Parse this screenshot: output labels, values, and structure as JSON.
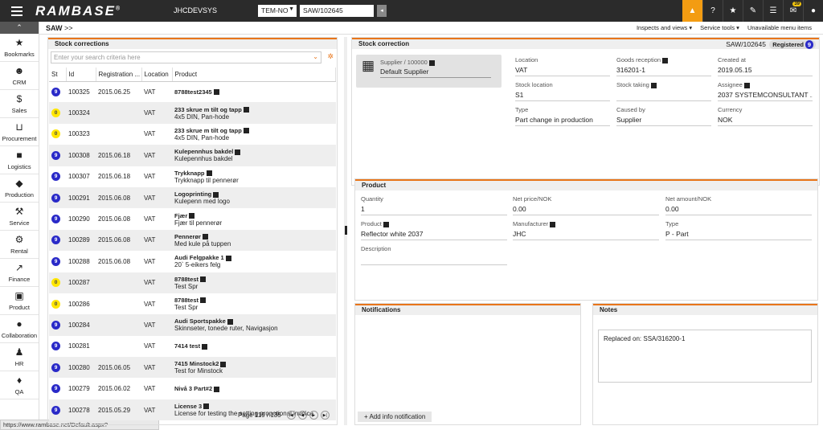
{
  "topbar": {
    "logo": "RAMBASE",
    "company": "JHCDEVSYS",
    "company_select": "TEM-NO",
    "doc_input": "SAW/102645",
    "mail_badge": "39"
  },
  "sidebar": {
    "items": [
      {
        "label": "Bookmarks",
        "icon": "star-icon"
      },
      {
        "label": "CRM",
        "icon": "users-icon"
      },
      {
        "label": "Sales",
        "icon": "money-bag-icon"
      },
      {
        "label": "Procurement",
        "icon": "cart-icon"
      },
      {
        "label": "Logistics",
        "icon": "truck-icon"
      },
      {
        "label": "Production",
        "icon": "boxes-icon"
      },
      {
        "label": "Service",
        "icon": "wrench-icon"
      },
      {
        "label": "Rental",
        "icon": "rental-icon"
      },
      {
        "label": "Finance",
        "icon": "chart-line-icon"
      },
      {
        "label": "Product",
        "icon": "box-icon"
      },
      {
        "label": "Collaboration",
        "icon": "chat-icon"
      },
      {
        "label": "HR",
        "icon": "person-icon"
      },
      {
        "label": "QA",
        "icon": "thumbs-up-icon"
      }
    ]
  },
  "status_url": "https://www.rambase.net/Default.aspx?target=JHCDEVSYS",
  "breadcrumb": {
    "main": "SAW",
    "rest": ">>"
  },
  "menu_links": [
    "Inspects and views ▾",
    "Service tools ▾",
    "Unavailable menu items"
  ],
  "left": {
    "title": "Stock corrections",
    "search_placeholder": "Enter your search criteria here",
    "columns": [
      "St",
      "Id",
      "Registration ...",
      "Location",
      "Product"
    ],
    "rows": [
      {
        "st": "9",
        "id": "100325",
        "date": "2015.06.25",
        "loc": "VAT",
        "name": "8788test2345",
        "desc": ""
      },
      {
        "st": "0",
        "id": "100324",
        "date": "",
        "loc": "VAT",
        "name": "233 skrue m tilt og tapp",
        "desc": "4x5 DIN, Pan-hode"
      },
      {
        "st": "0",
        "id": "100323",
        "date": "",
        "loc": "VAT",
        "name": "233 skrue m tilt og tapp",
        "desc": "4x5 DIN, Pan-hode"
      },
      {
        "st": "9",
        "id": "100308",
        "date": "2015.06.18",
        "loc": "VAT",
        "name": "Kulepennhus bakdel",
        "desc": "Kulepennhus bakdel"
      },
      {
        "st": "9",
        "id": "100307",
        "date": "2015.06.18",
        "loc": "VAT",
        "name": "Trykknapp",
        "desc": "Trykknapp til pennerør"
      },
      {
        "st": "9",
        "id": "100291",
        "date": "2015.06.08",
        "loc": "VAT",
        "name": "Logoprinting",
        "desc": "Kulepenn med logo"
      },
      {
        "st": "9",
        "id": "100290",
        "date": "2015.06.08",
        "loc": "VAT",
        "name": "Fjær",
        "desc": "Fjær til pennerør"
      },
      {
        "st": "9",
        "id": "100289",
        "date": "2015.06.08",
        "loc": "VAT",
        "name": "Pennerør",
        "desc": "Med kule på tuppen"
      },
      {
        "st": "9",
        "id": "100288",
        "date": "2015.06.08",
        "loc": "VAT",
        "name": "Audi Felgpakke 1",
        "desc": "20` 5-eikers felg"
      },
      {
        "st": "0",
        "id": "100287",
        "date": "",
        "loc": "VAT",
        "name": "8788test",
        "desc": "Test Spr"
      },
      {
        "st": "0",
        "id": "100286",
        "date": "",
        "loc": "VAT",
        "name": "8788test",
        "desc": "Test Spr"
      },
      {
        "st": "9",
        "id": "100284",
        "date": "",
        "loc": "VAT",
        "name": "Audi Sportspakke",
        "desc": "Skinnseter, tonede ruter, Navigasjon"
      },
      {
        "st": "9",
        "id": "100281",
        "date": "",
        "loc": "VAT",
        "name": "7414 test",
        "desc": ""
      },
      {
        "st": "9",
        "id": "100280",
        "date": "2015.06.05",
        "loc": "VAT",
        "name": "7415 Minstock2",
        "desc": "Test for Minstock"
      },
      {
        "st": "9",
        "id": "100279",
        "date": "2015.06.02",
        "loc": "VAT",
        "name": "Nivå 3 Part#2",
        "desc": ""
      },
      {
        "st": "9",
        "id": "100278",
        "date": "2015.05.29",
        "loc": "VAT",
        "name": "License 3",
        "desc": "License for testing the setting propotional invoice"
      }
    ],
    "pager": "Page 119 / 135"
  },
  "right": {
    "title": "Stock correction",
    "doc_id": "SAW/102645",
    "status": "Registered",
    "status_num": "9",
    "supplier_label": "Supplier / 100000",
    "supplier_value": "Default Supplier",
    "fields": {
      "location_l": "Location",
      "location_v": "VAT",
      "goods_l": "Goods reception",
      "goods_v": "316201-1",
      "created_l": "Created at",
      "created_v": "2019.05.15",
      "stockloc_l": "Stock location",
      "stockloc_v": "S1",
      "stocktaking_l": "Stock taking",
      "stocktaking_v": "",
      "assignee_l": "Assignee",
      "assignee_v": "2037 SYSTEMCONSULTANT ...",
      "type_l": "Type",
      "type_v": "Part change in production",
      "caused_l": "Caused by",
      "caused_v": "Supplier",
      "currency_l": "Currency",
      "currency_v": "NOK"
    }
  },
  "product": {
    "title": "Product",
    "quantity_l": "Quantity",
    "quantity_v": "1",
    "netprice_l": "Net price/NOK",
    "netprice_v": "0.00",
    "netamount_l": "Net amount/NOK",
    "netamount_v": "0.00",
    "product_l": "Product",
    "product_v": "Reflector white 2037",
    "manufacturer_l": "Manufacturer",
    "manufacturer_v": "JHC",
    "type_l": "Type",
    "type_v": "P - Part",
    "description_l": "Description",
    "description_v": ""
  },
  "notifications": {
    "title": "Notifications",
    "add_label": "Add info notification"
  },
  "notes": {
    "title": "Notes",
    "text": "Replaced on: SSA/316200-1"
  }
}
